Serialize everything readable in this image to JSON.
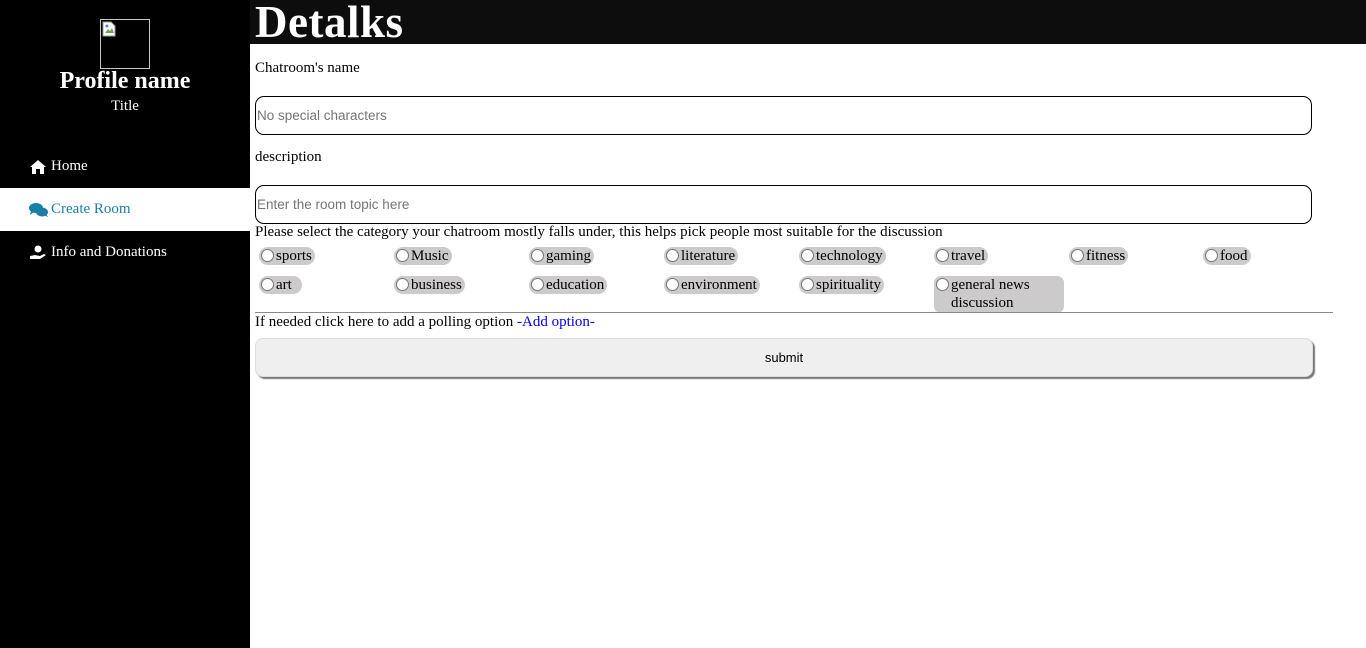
{
  "sidebar": {
    "profile_name": "Profile name",
    "profile_title": "Title",
    "nav": [
      {
        "label": "Home",
        "icon": "home-icon"
      },
      {
        "label": "Create Room",
        "icon": "chat-bubbles-icon",
        "active": true
      },
      {
        "label": "Info and Donations",
        "icon": "donation-hand-icon"
      }
    ]
  },
  "header": {
    "brand": "Detalks"
  },
  "form": {
    "name_label": "Chatroom's name",
    "name_placeholder": "No special characters",
    "description_label": "description",
    "description_placeholder": "Enter the room topic here",
    "category_prompt": "Please select the category your chatroom mostly falls under, this helps pick people most suitable for the discussion",
    "categories": [
      "sports",
      "Music",
      "gaming",
      "literature",
      "technology",
      "travel",
      "fitness",
      "food",
      "art",
      "business",
      "education",
      "environment",
      "spirituality",
      "general news discussion"
    ],
    "poll_text": "If needed click here to add a polling option ",
    "poll_link": "-Add option-",
    "submit_label": "submit"
  },
  "colors": {
    "sidebar_bg": "#000000",
    "active_text": "#1a7fa7",
    "link": "#0000ee",
    "chip_bg": "#cccaca"
  }
}
